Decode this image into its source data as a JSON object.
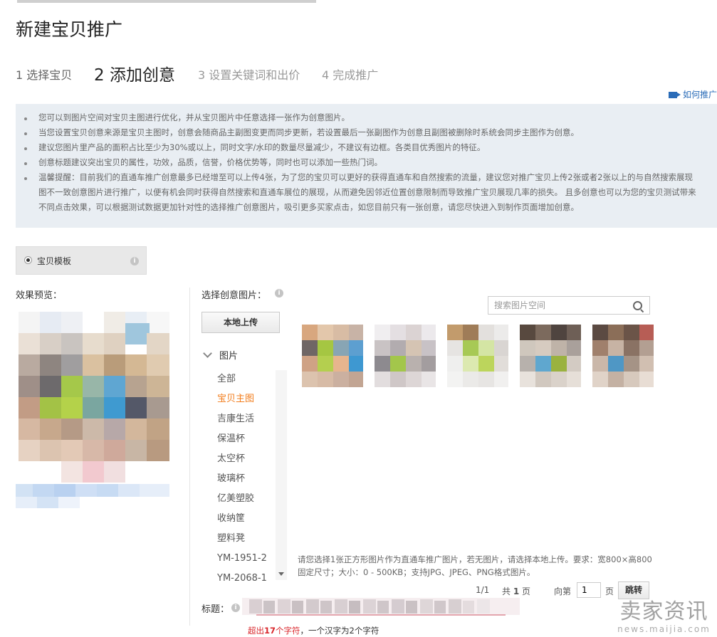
{
  "page": {
    "title": "新建宝贝推广"
  },
  "steps": [
    {
      "label": "1 选择宝贝"
    },
    {
      "label": "2 添加创意"
    },
    {
      "label": "3 设置关键词和出价"
    },
    {
      "label": "4 完成推广"
    }
  ],
  "help_link": "如何推广",
  "tips": [
    "您可以到图片空间对宝贝主图进行优化，并从宝贝图片中任意选择一张作为创意图片。",
    "当您设置宝贝创意来源是宝贝主图时，创意会随商品主副图变更而同步更新，若设置最后一张副图作为创意且副图被删除时系统会同步主图作为创意。",
    "建议您图片里产品的面积占比至少为30%或以上，同时文字/水印的数量尽量减少，不建议有边框。各类目优秀图片的特征。",
    "创意标题建议突出宝贝的属性，功效，品质，信誉，价格优势等，同时也可以添加一些热门词。",
    "温馨提醒：目前我们的直通车推广创意最多已经增至可以上传4张，为了您的宝贝可以更好的获得直通车和自然搜索的流量，建议您对推广宝贝上传2张或者2张以上的与自然搜索展现"
  ],
  "tips_continuation": [
    "图不一致创意图片进行推广，以便有机会同时获得自然搜索和直通车展位的展现，从而避免因邻近位置创意限制而导致推广宝贝展现几率的损失。 且多创意也可以为您的宝贝测试带来",
    "不同点击效果，可以根据测试数据更加针对性的选择推广创意图片，吸引更多买家点击，如您目前只有一张创意，请您尽快进入到制作页面增加创意。"
  ],
  "template": {
    "label": "宝贝模板",
    "info": "i"
  },
  "preview_label": "效果预览：",
  "select_label": "选择创意图片：",
  "upload_button": "本地上传",
  "search": {
    "placeholder": "搜索图片空间"
  },
  "tree": {
    "root": "图片",
    "items": [
      "全部",
      "宝贝主图",
      "吉康生活",
      "保温杯",
      "太空杯",
      "玻璃杯",
      "亿美塑胶",
      "收纳筐",
      "塑料凳",
      "YM-1951-2",
      "YM-2068-1"
    ],
    "active_index": 1
  },
  "hint": "请您选择1张正方形图片作为直通车推广图片，若无图片，请选择本地上传。要求：宽800×高800固定尺寸；大小：0 - 500KB；支持JPG、JPEG、PNG格式图片。",
  "pager": {
    "page": "1/1",
    "total_prefix": "共",
    "total_pages": "1",
    "total_suffix": "页",
    "goto_prefix": "向第",
    "goto_value": "1",
    "goto_suffix": "页",
    "jump": "跳转"
  },
  "title_field": {
    "label": "标题："
  },
  "error": {
    "prefix": "超出",
    "count": "17",
    "unit": "个字符",
    "note": "，一个汉字为2个字符"
  },
  "watermark": {
    "big": "卖家资讯",
    "small": "news.maijia.com"
  },
  "colors": {
    "accent_orange": "#f27c1b",
    "error_red": "#d9262b",
    "link_blue": "#2a6cb8",
    "tips_bg": "#e9eef3"
  }
}
